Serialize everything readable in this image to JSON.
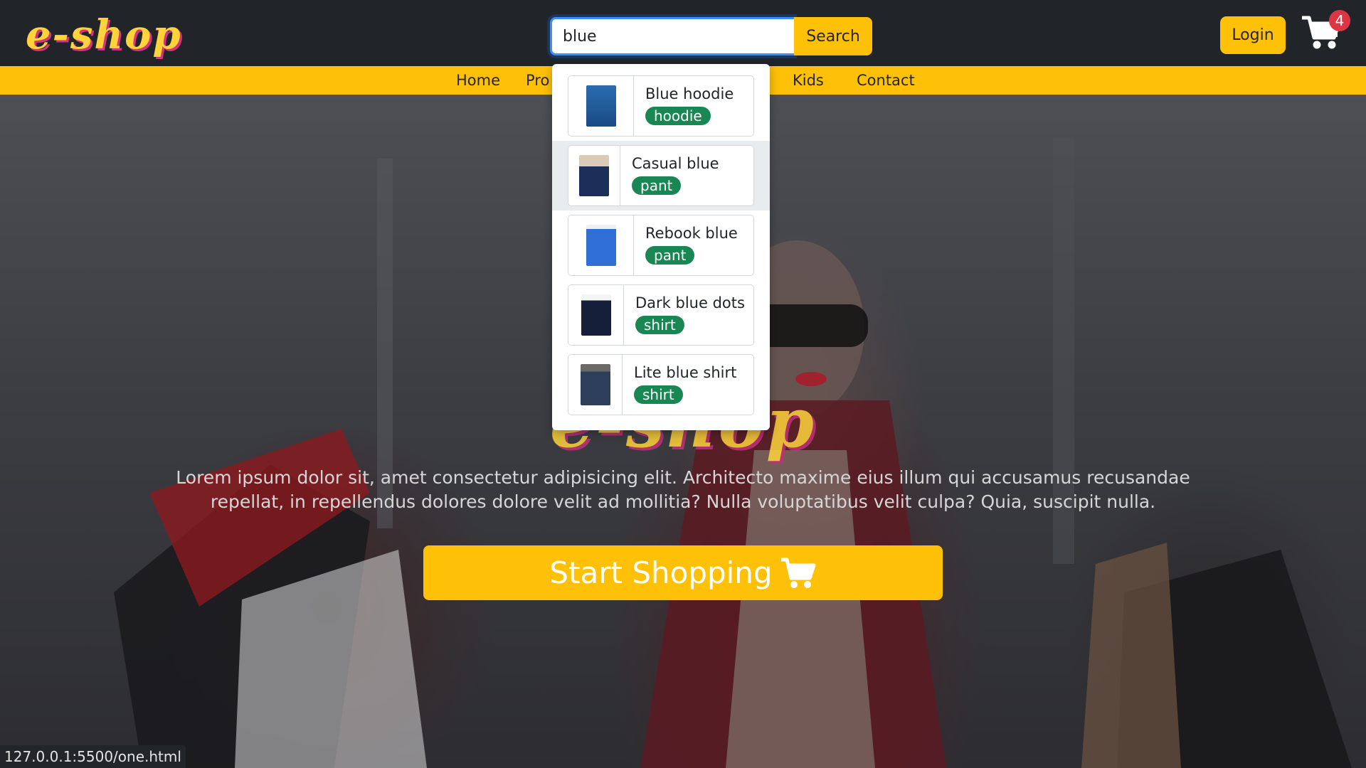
{
  "header": {
    "logo": "e-shop",
    "search": {
      "value": "blue",
      "button": "Search"
    },
    "login": "Login",
    "cart_count": "4"
  },
  "nav": {
    "items": [
      "Home",
      "Pro",
      "Kids",
      "Contact"
    ]
  },
  "search_results": [
    {
      "title": "Blue hoodie",
      "tag": "hoodie",
      "thumb": "hoodie-image",
      "color": "#1f5a9e",
      "active": false
    },
    {
      "title": "Casual blue",
      "tag": "pant",
      "thumb": "pant-image",
      "color": "#1c2f58",
      "active": true
    },
    {
      "title": "Rebook blue",
      "tag": "pant",
      "thumb": "pant-image",
      "color": "#2f6fd6",
      "active": false
    },
    {
      "title": "Dark blue dots",
      "tag": "shirt",
      "thumb": "shirt-image",
      "color": "#151f3a",
      "active": false
    },
    {
      "title": "Lite blue shirt",
      "tag": "shirt",
      "thumb": "shirt-image",
      "color": "#2d3e5a",
      "active": false
    }
  ],
  "hero": {
    "logo": "e-shop",
    "text": "Lorem ipsum dolor sit, amet consectetur adipisicing elit. Architecto maxime eius illum qui accusamus recusandae repellat, in repellendus dolores dolore velit ad mollitia? Nulla voluptatibus velit culpa? Quia, suscipit nulla.",
    "button": "Start Shopping"
  },
  "status_url": "127.0.0.1:5500/one.html",
  "colors": {
    "accent": "#ffc107",
    "header_bg": "#212529",
    "badge_green": "#198754",
    "badge_red": "#dc3545",
    "logo_yellow": "#ffd43b",
    "logo_pink": "#d63384"
  }
}
